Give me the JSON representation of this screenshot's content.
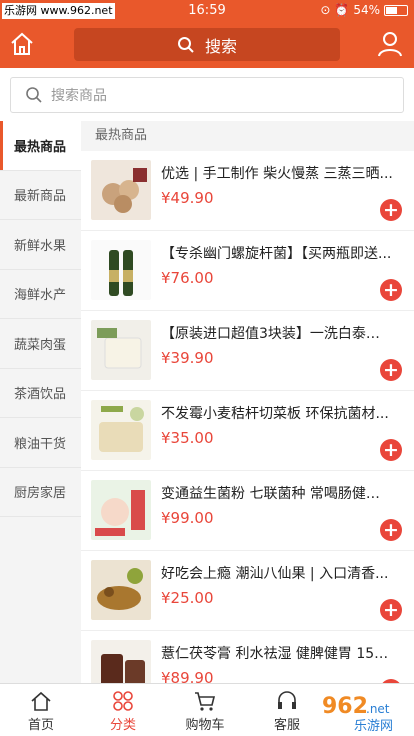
{
  "status_bar": {
    "carrier": "乐游网 www.962.net",
    "time": "16:59",
    "battery": "54%",
    "battery_level": 0.54
  },
  "header": {
    "search_label": "搜索"
  },
  "search": {
    "placeholder": "搜索商品"
  },
  "sidebar": {
    "items": [
      {
        "label": "最热商品"
      },
      {
        "label": "最新商品"
      },
      {
        "label": "新鲜水果"
      },
      {
        "label": "海鲜水产"
      },
      {
        "label": "蔬菜肉蛋"
      },
      {
        "label": "茶酒饮品"
      },
      {
        "label": "粮油干货"
      },
      {
        "label": "厨房家居"
      }
    ]
  },
  "main": {
    "section_title": "最热商品",
    "products": [
      {
        "title": "优选 | 手工制作 柴火慢蒸 三蒸三晒...",
        "price": "¥49.90"
      },
      {
        "title": "【专杀幽门螺旋杆菌】【买两瓶即送...",
        "price": "¥76.00"
      },
      {
        "title": "【原装进口超值3块装】一洗白泰国...",
        "price": "¥39.90"
      },
      {
        "title": "不发霉小麦秸杆切菜板 环保抗菌材...",
        "price": "¥35.00"
      },
      {
        "title": "变通益生菌粉 七联菌种 常喝肠健康 ...",
        "price": "¥99.00"
      },
      {
        "title": "好吃会上瘾 潮汕八仙果 | 入口清香...",
        "price": "¥25.00"
      },
      {
        "title": "薏仁茯苓膏 利水祛湿 健脾健胃 150...",
        "price": "¥89.90"
      }
    ]
  },
  "tabbar": {
    "items": [
      {
        "label": "首页"
      },
      {
        "label": "分类"
      },
      {
        "label": "购物车"
      },
      {
        "label": "客服"
      }
    ]
  },
  "watermark": {
    "text": "962.net 乐游网"
  },
  "colors": {
    "brand": "#e9582b",
    "price": "#e9463a"
  }
}
